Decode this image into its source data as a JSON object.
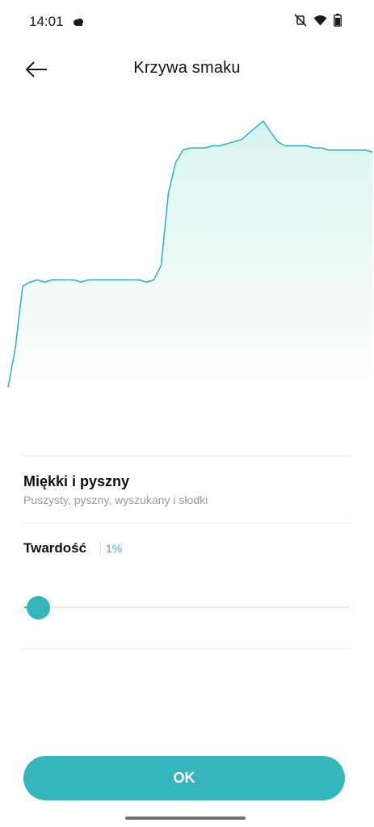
{
  "status_bar": {
    "time": "14:01",
    "icons": [
      "cloud-icon",
      "vibrate-off-icon",
      "wifi-icon",
      "battery-icon"
    ]
  },
  "header": {
    "title": "Krzywa smaku",
    "back_icon": "arrow-left-icon"
  },
  "chart_data": {
    "type": "area",
    "x": [
      0,
      2,
      4,
      6,
      8,
      10,
      12,
      14,
      16,
      18,
      20,
      22,
      24,
      26,
      28,
      30,
      32,
      34,
      36,
      38,
      40,
      42,
      44,
      46,
      48,
      50,
      52,
      54,
      56,
      58,
      60,
      62,
      64,
      66,
      68,
      70,
      72,
      74,
      76,
      78,
      80,
      82,
      84,
      86,
      88,
      90,
      92,
      94,
      96,
      98,
      100
    ],
    "values": [
      1,
      20,
      50,
      52,
      53,
      52,
      53,
      53,
      53,
      53,
      52,
      53,
      53,
      53,
      53,
      53,
      53,
      53,
      53,
      52,
      53,
      60,
      95,
      110,
      116,
      117,
      117,
      117,
      118,
      118,
      119,
      120,
      121,
      124,
      127,
      130,
      125,
      120,
      118,
      118,
      118,
      118,
      117,
      117,
      116,
      116,
      116,
      116,
      116,
      116,
      115
    ],
    "ylim": [
      0,
      130
    ],
    "grid": false,
    "colors": {
      "line": "#35b6bd",
      "fill_top": "#d8f4ef",
      "fill_bottom": "#ffffff"
    }
  },
  "profile": {
    "title": "Miękki i pyszny",
    "description": "Puszysty, pyszny, wyszukany i słodki"
  },
  "hardness": {
    "label": "Twardość",
    "value_text": "1%",
    "value": 1
  },
  "ok_button": {
    "label": "OK"
  },
  "colors": {
    "accent": "#35b6bd",
    "text": "#111111",
    "secondary_text": "#9a9a9a"
  }
}
